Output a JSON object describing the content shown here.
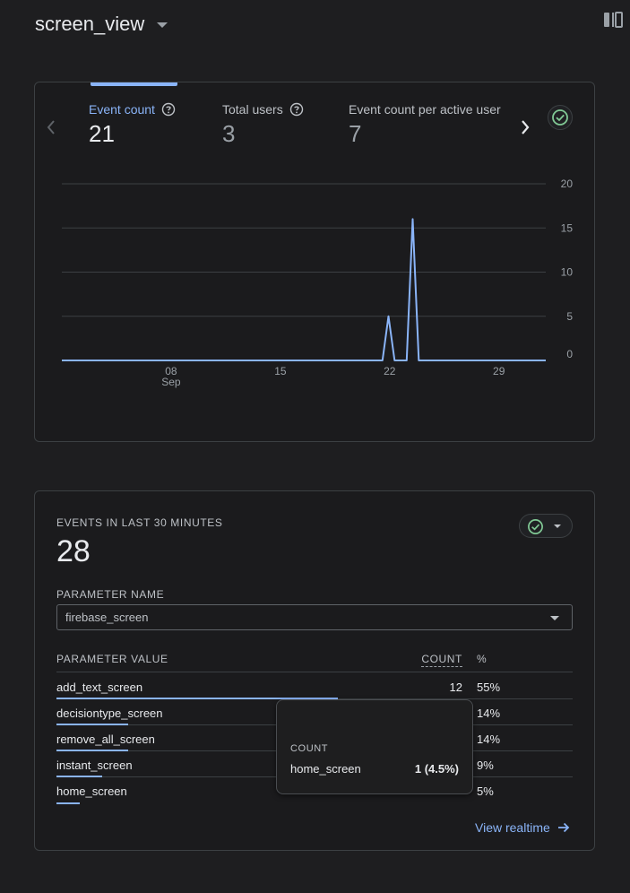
{
  "header": {
    "title": "screen_view"
  },
  "metrics": [
    {
      "label": "Event count",
      "value": "21"
    },
    {
      "label": "Total users",
      "value": "3"
    },
    {
      "label": "Event count per active user",
      "value": "7"
    }
  ],
  "chart_data": {
    "type": "line",
    "x_tick_labels": [
      "08",
      "15",
      "22",
      "29"
    ],
    "x_month_label": "Sep",
    "y_ticks": [
      0,
      5,
      10,
      15,
      20
    ],
    "ylim": [
      0,
      20
    ],
    "grid": true,
    "series": [
      {
        "values": [
          0,
          0,
          0,
          0,
          0,
          0,
          0,
          0,
          0,
          0,
          0,
          0,
          0,
          0,
          0,
          0,
          0,
          0,
          0,
          0,
          0,
          0,
          0,
          0,
          0,
          0,
          0,
          0,
          0,
          0,
          0,
          0,
          0,
          0,
          0,
          0,
          0,
          0,
          0,
          0,
          0,
          0,
          0,
          0,
          0,
          0,
          0,
          0,
          0,
          0,
          0,
          0,
          0,
          0,
          5,
          0,
          0,
          0,
          16,
          0,
          0,
          0,
          0,
          0,
          0,
          0,
          0,
          0,
          0,
          0,
          0,
          0,
          0,
          0,
          0,
          0,
          0,
          0,
          0,
          0,
          0
        ]
      }
    ],
    "line_color": "#8ab4f8"
  },
  "realtime": {
    "label": "EVENTS IN LAST 30 MINUTES",
    "value": "28",
    "param_label": "PARAMETER NAME",
    "param_value": "firebase_screen",
    "col_value": "PARAMETER VALUE",
    "col_count": "COUNT",
    "col_pct": "%",
    "rows": [
      {
        "name": "add_text_screen",
        "count": "12",
        "pct": "55%",
        "share": 0.55
      },
      {
        "name": "decisiontype_screen",
        "count": "",
        "pct": "14%",
        "share": 0.14
      },
      {
        "name": "remove_all_screen",
        "count": "",
        "pct": "14%",
        "share": 0.14
      },
      {
        "name": "instant_screen",
        "count": "",
        "pct": "9%",
        "share": 0.09
      },
      {
        "name": "home_screen",
        "count": "",
        "pct": "5%",
        "share": 0.045
      }
    ],
    "view_link": "View realtime"
  },
  "tooltip": {
    "label": "COUNT",
    "name": "home_screen",
    "value": "1 (4.5%)"
  },
  "colors": {
    "accent": "#8ab4f8",
    "check": "#81c995"
  }
}
